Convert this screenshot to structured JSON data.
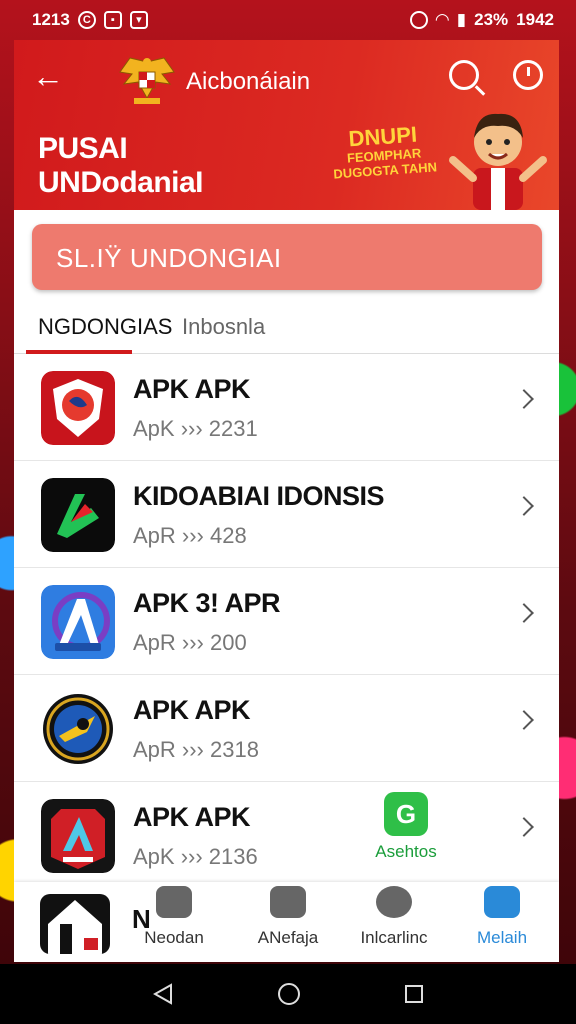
{
  "status_bar": {
    "time": "1213",
    "battery": "23%",
    "clock_right": "1942"
  },
  "header": {
    "brand": "Aicbonáiain",
    "title": "PUSAI\nUNDodaniaI",
    "promo": {
      "line1": "DNUPI",
      "line2": "FEOMPHAR",
      "line3": "DUGOGTA TAHN"
    }
  },
  "search": {
    "text": "SL.IŸ  UNDONGIAI"
  },
  "tabs": [
    {
      "label": "NGDONGIAS",
      "active": true
    },
    {
      "label": "Inbosnla",
      "active": false
    }
  ],
  "apps": [
    {
      "name": "APK APK",
      "meta": "ApK ››› 2231",
      "icon": "shield-app-icon"
    },
    {
      "name": "KIDOABIAI IDONSIS",
      "meta": "ApR ››› 428",
      "icon": "green-arrow-app-icon"
    },
    {
      "name": "APK 3! APR",
      "meta": "ApR ››› 200",
      "icon": "blue-a-app-icon"
    },
    {
      "name": "APK APK",
      "meta": "ApR ››› 2318",
      "icon": "circle-emblem-app-icon"
    },
    {
      "name": "APK APK",
      "meta": "ApK ››› 2136",
      "icon": "red-x-app-icon"
    }
  ],
  "floating_badge": {
    "label": "Asehtos"
  },
  "partial_row": {
    "name": "N"
  },
  "bottom_nav": [
    {
      "label": "Neodan",
      "icon": "chat-icon",
      "active": false
    },
    {
      "label": "ANefaja",
      "icon": "camera-icon",
      "active": false
    },
    {
      "label": "Inlcarlinc",
      "icon": "message-icon",
      "active": false
    },
    {
      "label": "Melaih",
      "icon": "profile-icon",
      "active": true
    }
  ],
  "colors": {
    "primary": "#d11a1c",
    "search_bg": "#ee7a6e",
    "active_nav": "#2a8ad8",
    "badge_green": "#2fbf48"
  }
}
